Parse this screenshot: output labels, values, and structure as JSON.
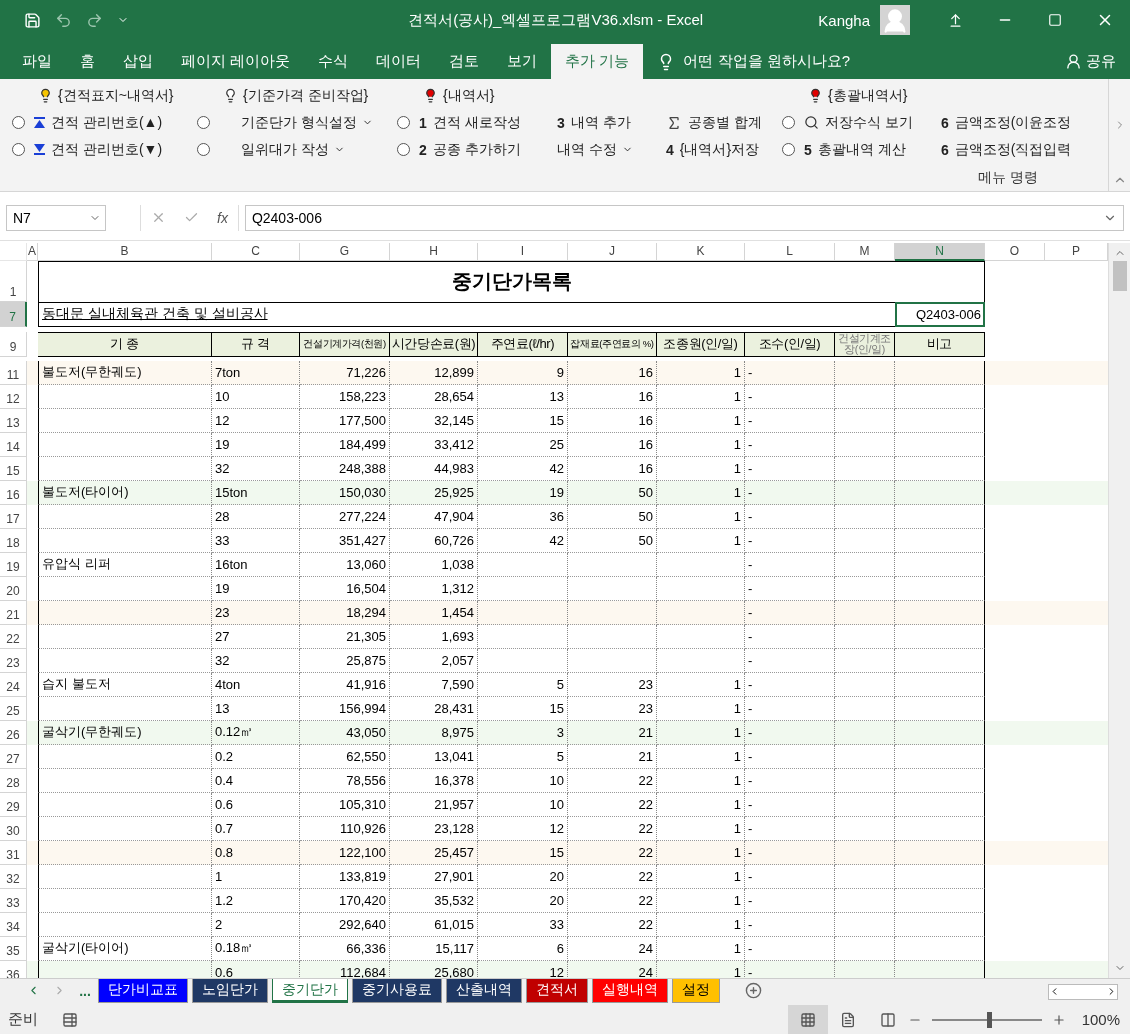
{
  "window": {
    "title": "견적서(공사)_엑셀프로그램V36.xlsm  -  Excel",
    "user": "Kangha"
  },
  "menu_tabs": [
    {
      "label": "파일",
      "selected": false
    },
    {
      "label": "홈",
      "selected": false
    },
    {
      "label": "삽입",
      "selected": false
    },
    {
      "label": "페이지 레이아웃",
      "selected": false
    },
    {
      "label": "수식",
      "selected": false
    },
    {
      "label": "데이터",
      "selected": false
    },
    {
      "label": "검토",
      "selected": false
    },
    {
      "label": "보기",
      "selected": false
    },
    {
      "label": "추가 기능",
      "selected": true
    }
  ],
  "tell_me": "어떤 작업을 원하시나요?",
  "share": "공유",
  "ribbon": {
    "columns": [
      {
        "header": {
          "text": "{견적표지~내역서}",
          "color": "#f5c400"
        },
        "items": [
          {
            "checked": false,
            "label": "견적 관리번호(▲)"
          },
          {
            "checked": false,
            "label": "견적 관리번호(▼)"
          }
        ]
      },
      {
        "header": {
          "text": "{기준가격 준비작업}",
          "color": "#ffffff"
        },
        "items": [
          {
            "checked": false,
            "label": "기준단가 형식설정",
            "dropdown": true
          },
          {
            "checked": false,
            "label": "일위대가 작성",
            "dropdown": true
          }
        ]
      },
      {
        "header": {
          "text": "{내역서}",
          "color": "#e00000"
        },
        "items": [
          {
            "checked": false,
            "number": "1",
            "label": "견적 새로작성"
          },
          {
            "checked": false,
            "number": "2",
            "label": "공종 추가하기"
          }
        ]
      },
      {
        "items": [
          {
            "number": "3",
            "label": "내역 추가"
          },
          {
            "label": "내역 수정",
            "dropdown": true
          }
        ]
      },
      {
        "items": [
          {
            "label": "공종별 합계"
          },
          {
            "number": "4",
            "label": "{내역서}저장"
          }
        ]
      },
      {
        "header": {
          "text": "{총괄내역서}",
          "color": "#e00000"
        },
        "items": [
          {
            "checked": false,
            "label": "저장수식 보기"
          },
          {
            "checked": false,
            "number": "5",
            "label": "총괄내역 계산"
          }
        ]
      },
      {
        "items": [
          {
            "number": "6",
            "label": "금액조정(이윤조정"
          },
          {
            "number": "6",
            "label": "금액조정(직접입력"
          }
        ]
      }
    ],
    "group_label": "메뉴 명령"
  },
  "formula_bar": {
    "name_box": "N7",
    "function_label": "fx",
    "formula": "Q2403-006"
  },
  "columns": [
    {
      "letter": "A",
      "selected": false
    },
    {
      "letter": "B",
      "selected": false
    },
    {
      "letter": "C",
      "selected": false
    },
    {
      "letter": "G",
      "selected": false
    },
    {
      "letter": "H",
      "selected": false
    },
    {
      "letter": "I",
      "selected": false
    },
    {
      "letter": "J",
      "selected": false
    },
    {
      "letter": "K",
      "selected": false
    },
    {
      "letter": "L",
      "selected": false
    },
    {
      "letter": "M",
      "selected": false
    },
    {
      "letter": "N",
      "selected": true
    },
    {
      "letter": "O",
      "selected": false
    },
    {
      "letter": "P",
      "selected": false
    }
  ],
  "title_row": {
    "number": "1",
    "selected": false,
    "text": "중기단가목록"
  },
  "project_row": {
    "number": "7",
    "selected": true,
    "name": "동대문 실내체육관 건축 및 설비공사",
    "code": "Q2403-006"
  },
  "header_row": {
    "number": "9",
    "selected": false,
    "labels": [
      {
        "text": "기  종",
        "kind": "normal"
      },
      {
        "text": "규 격",
        "kind": "normal"
      },
      {
        "text": "건설기계가격(천원)",
        "kind": "small"
      },
      {
        "text": "시간당손료(원)",
        "kind": "normal"
      },
      {
        "text": "주연료(ℓ/hr)",
        "kind": "normal"
      },
      {
        "text": "잡재료(주연료의 %)",
        "kind": "small"
      },
      {
        "text": "조종원(인/일)",
        "kind": "normal"
      },
      {
        "text": "조수(인/일)",
        "kind": "normal"
      },
      {
        "text": "건설기계조장(인/일)",
        "kind": "tiny"
      },
      {
        "text": "비고",
        "kind": "normal"
      }
    ]
  },
  "rows": [
    {
      "number": "11",
      "selected": false,
      "color": "#fdf8f0",
      "cells": [
        "불도저(무한궤도)",
        "7ton",
        "71,226",
        "12,899",
        "9",
        "16",
        "1",
        "-",
        null,
        null
      ]
    },
    {
      "number": "12",
      "selected": false,
      "cells": [
        null,
        "10",
        "158,223",
        "28,654",
        "13",
        "16",
        "1",
        "-",
        null,
        null
      ]
    },
    {
      "number": "13",
      "selected": false,
      "cells": [
        null,
        "12",
        "177,500",
        "32,145",
        "15",
        "16",
        "1",
        "-",
        null,
        null
      ]
    },
    {
      "number": "14",
      "selected": false,
      "cells": [
        null,
        "19",
        "184,499",
        "33,412",
        "25",
        "16",
        "1",
        "-",
        null,
        null
      ]
    },
    {
      "number": "15",
      "selected": false,
      "cells": [
        null,
        "32",
        "248,388",
        "44,983",
        "42",
        "16",
        "1",
        "-",
        null,
        null
      ]
    },
    {
      "number": "16",
      "selected": false,
      "color": "#f1f9ef",
      "cells": [
        "불도저(타이어)",
        "15ton",
        "150,030",
        "25,925",
        "19",
        "50",
        "1",
        "-",
        null,
        null
      ]
    },
    {
      "number": "17",
      "selected": false,
      "cells": [
        null,
        "28",
        "277,224",
        "47,904",
        "36",
        "50",
        "1",
        "-",
        null,
        null
      ]
    },
    {
      "number": "18",
      "selected": false,
      "cells": [
        null,
        "33",
        "351,427",
        "60,726",
        "42",
        "50",
        "1",
        "-",
        null,
        null
      ]
    },
    {
      "number": "19",
      "selected": false,
      "cells": [
        "유압식 리퍼",
        "16ton",
        "13,060",
        "1,038",
        null,
        null,
        null,
        "-",
        null,
        null
      ]
    },
    {
      "number": "20",
      "selected": false,
      "cells": [
        null,
        "19",
        "16,504",
        "1,312",
        null,
        null,
        null,
        "-",
        null,
        null
      ]
    },
    {
      "number": "21",
      "selected": false,
      "color": "#fdf8f0",
      "cells": [
        null,
        "23",
        "18,294",
        "1,454",
        null,
        null,
        null,
        "-",
        null,
        null
      ]
    },
    {
      "number": "22",
      "selected": false,
      "cells": [
        null,
        "27",
        "21,305",
        "1,693",
        null,
        null,
        null,
        "-",
        null,
        null
      ]
    },
    {
      "number": "23",
      "selected": false,
      "cells": [
        null,
        "32",
        "25,875",
        "2,057",
        null,
        null,
        null,
        "-",
        null,
        null
      ]
    },
    {
      "number": "24",
      "selected": false,
      "cells": [
        "습지 불도저",
        "4ton",
        "41,916",
        "7,590",
        "5",
        "23",
        "1",
        "-",
        null,
        null
      ]
    },
    {
      "number": "25",
      "selected": false,
      "cells": [
        null,
        "13",
        "156,994",
        "28,431",
        "15",
        "23",
        "1",
        "-",
        null,
        null
      ]
    },
    {
      "number": "26",
      "selected": false,
      "color": "#f1f9ef",
      "cells": [
        "굴삭기(무한궤도)",
        "0.12㎥",
        "43,050",
        "8,975",
        "3",
        "21",
        "1",
        "-",
        null,
        null
      ]
    },
    {
      "number": "27",
      "selected": false,
      "cells": [
        null,
        "0.2",
        "62,550",
        "13,041",
        "5",
        "21",
        "1",
        "-",
        null,
        null
      ]
    },
    {
      "number": "28",
      "selected": false,
      "cells": [
        null,
        "0.4",
        "78,556",
        "16,378",
        "10",
        "22",
        "1",
        "-",
        null,
        null
      ]
    },
    {
      "number": "29",
      "selected": false,
      "cells": [
        null,
        "0.6",
        "105,310",
        "21,957",
        "10",
        "22",
        "1",
        "-",
        null,
        null
      ]
    },
    {
      "number": "30",
      "selected": false,
      "cells": [
        null,
        "0.7",
        "110,926",
        "23,128",
        "12",
        "22",
        "1",
        "-",
        null,
        null
      ]
    },
    {
      "number": "31",
      "selected": false,
      "color": "#fdf8f0",
      "cells": [
        null,
        "0.8",
        "122,100",
        "25,457",
        "15",
        "22",
        "1",
        "-",
        null,
        null
      ]
    },
    {
      "number": "32",
      "selected": false,
      "cells": [
        null,
        "1",
        "133,819",
        "27,901",
        "20",
        "22",
        "1",
        "-",
        null,
        null
      ]
    },
    {
      "number": "33",
      "selected": false,
      "cells": [
        null,
        "1.2",
        "170,420",
        "35,532",
        "20",
        "22",
        "1",
        "-",
        null,
        null
      ]
    },
    {
      "number": "34",
      "selected": false,
      "cells": [
        null,
        "2",
        "292,640",
        "61,015",
        "33",
        "22",
        "1",
        "-",
        null,
        null
      ]
    },
    {
      "number": "35",
      "selected": false,
      "cells": [
        "굴삭기(타이어)",
        "0.18㎥",
        "66,336",
        "15,117",
        "6",
        "24",
        "1",
        "-",
        null,
        null
      ]
    },
    {
      "number": "36",
      "selected": false,
      "color": "#f1f9ef",
      "cells": [
        null,
        "0.6",
        "112,684",
        "25,680",
        "12",
        "24",
        "1",
        "-",
        null,
        null
      ]
    }
  ],
  "sheet_nav": "...",
  "sheet_tabs": [
    {
      "label": "단가비교표",
      "selected": false,
      "color": "#0000ff"
    },
    {
      "label": "노임단가",
      "selected": false,
      "color": "#1f3864"
    },
    {
      "label": "중기단가",
      "selected": true,
      "color": "#ffffff"
    },
    {
      "label": "중기사용료",
      "selected": false,
      "color": "#1f3864"
    },
    {
      "label": "산출내역",
      "selected": false,
      "color": "#1f3864"
    },
    {
      "label": "견적서",
      "selected": false,
      "color": "#c00000"
    },
    {
      "label": "실행내역",
      "selected": false,
      "color": "#ff0000"
    },
    {
      "label": "설정",
      "selected": false,
      "color": "#ffc000"
    }
  ],
  "status_bar": {
    "status": "준비",
    "zoom": "100%",
    "level": 0.5
  }
}
